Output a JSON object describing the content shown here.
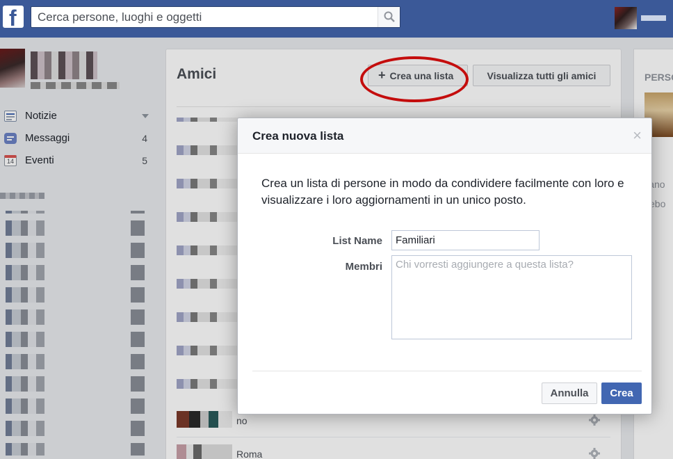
{
  "header": {
    "logo": "f",
    "search_placeholder": "Cerca persone, luoghi e oggetti"
  },
  "sidebar": {
    "items": [
      {
        "label": "Notizie",
        "count": "",
        "icon": "news-icon"
      },
      {
        "label": "Messaggi",
        "count": "4",
        "icon": "messages-icon"
      },
      {
        "label": "Eventi",
        "count": "5",
        "icon": "calendar-icon",
        "icon_text": "14"
      }
    ]
  },
  "friends_panel": {
    "title": "Amici",
    "create_list_plus": "+",
    "create_list_label": "Crea una lista",
    "view_all_label": "Visualizza tutti gli amici",
    "rows": [
      {
        "text": "no"
      },
      {
        "text": "Roma"
      }
    ]
  },
  "right_column": {
    "title": "PERSO",
    "text_1": "liano",
    "text_2": "cebo"
  },
  "dialog": {
    "title": "Crea nuova lista",
    "close": "×",
    "description": "Crea un lista di persone in modo da condividere facilmente con loro e visualizzare i loro aggiornamenti in un unico posto.",
    "name_label": "List Name",
    "name_value": "Familiari",
    "members_label": "Membri",
    "members_placeholder": "Chi vorresti aggiungere a questa lista?",
    "cancel_label": "Annulla",
    "create_label": "Crea"
  },
  "colors": {
    "brand": "#3b5998",
    "primary_button": "#4267b2",
    "annotation": "#e00f0f"
  }
}
